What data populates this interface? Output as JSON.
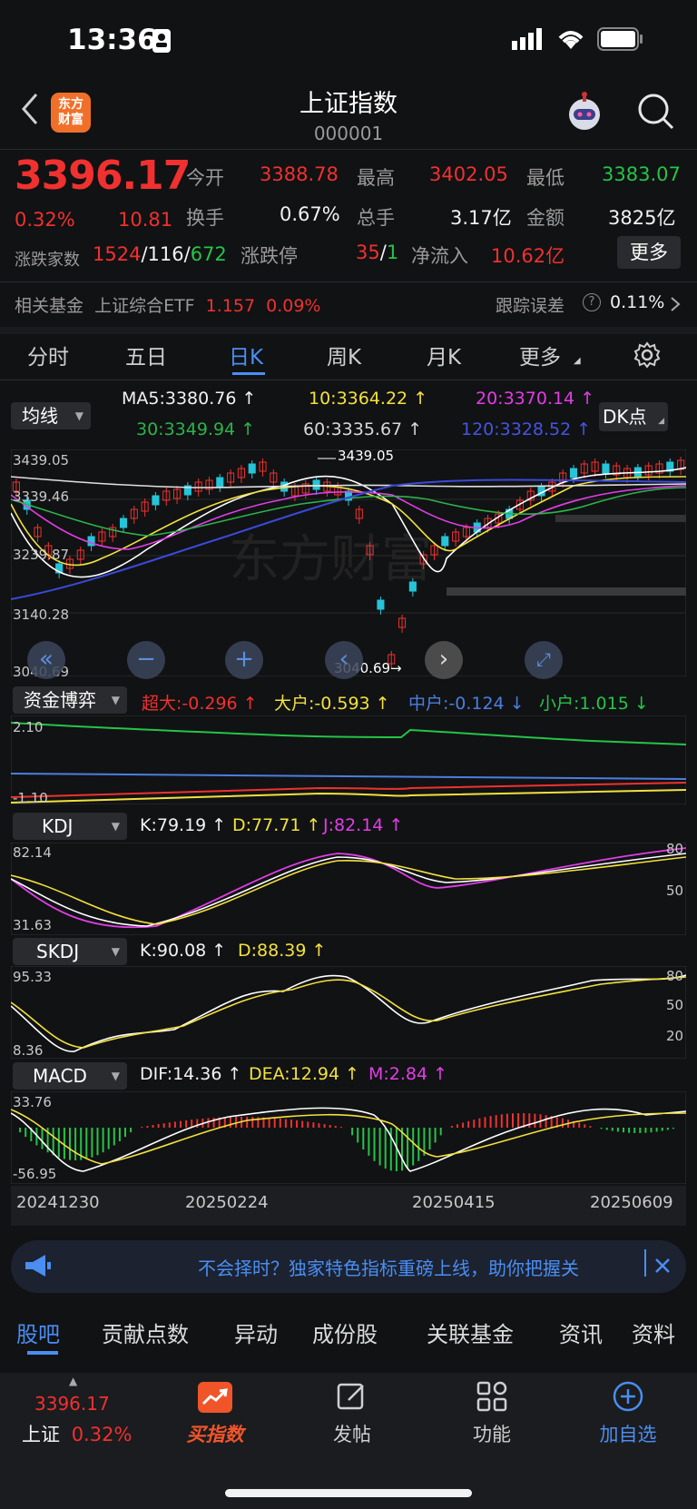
{
  "status": {
    "time": "13:36"
  },
  "header": {
    "title": "上证指数",
    "code": "000001",
    "logo_line1": "东方",
    "logo_line2": "财富"
  },
  "quote": {
    "price": "3396.17",
    "change_pct": "0.32%",
    "change": "10.81",
    "open_label": "今开",
    "open": "3388.78",
    "high_label": "最高",
    "high": "3402.05",
    "low_label": "最低",
    "low": "3383.07",
    "turnover_label": "换手",
    "turnover": "0.67%",
    "volume_label": "总手",
    "volume": "3.17亿",
    "amount_label": "金额",
    "amount": "3825亿",
    "updown_label": "涨跌家数",
    "up": "1524",
    "flat": "116",
    "down": "672",
    "limit_label": "涨跌停",
    "limit_up": "35",
    "limit_down": "1",
    "netflow_label": "净流入",
    "netflow": "10.62亿",
    "more": "更多"
  },
  "fund": {
    "label": "相关基金",
    "name": "上证综合ETF",
    "price": "1.157",
    "pct": "0.09%",
    "track_label": "跟踪误差",
    "track_value": "0.11%"
  },
  "tabs": [
    "分时",
    "五日",
    "日K",
    "周K",
    "月K",
    "更多"
  ],
  "ma_panel": {
    "selector": "均线",
    "ma5": "MA5:3380.76",
    "ma10": "10:3364.22",
    "ma20": "20:3370.14",
    "ma30": "30:3349.94",
    "ma60": "60:3335.67",
    "ma120": "120:3328.52",
    "dk": "DK点",
    "axis": [
      "3439.05",
      "3339.46",
      "3239.87",
      "3140.28",
      "3040.69"
    ],
    "max_label": "3439.05",
    "min_label": "3040.69→"
  },
  "fund_game": {
    "selector": "资金博弈",
    "super": "超大:-0.296",
    "large": "大户:-0.593",
    "medium": "中户:-0.124",
    "small": "小户:1.015",
    "axis_top": "2.10",
    "axis_bottom": "-1.10"
  },
  "kdj": {
    "selector": "KDJ",
    "k": "K:79.19",
    "d": "D:77.71",
    "j": "J:82.14",
    "axis_top": "82.14",
    "axis_bottom": "31.63",
    "r1": "80",
    "r2": "50"
  },
  "skdj": {
    "selector": "SKDJ",
    "k": "K:90.08",
    "d": "D:88.39",
    "axis_top": "95.33",
    "axis_bottom": "8.36",
    "r1": "80",
    "r2": "50",
    "r3": "20"
  },
  "macd": {
    "selector": "MACD",
    "dif": "DIF:14.36",
    "dea": "DEA:12.94",
    "m": "M:2.84",
    "axis_top": "33.76",
    "axis_bottom": "-56.95"
  },
  "dates": [
    "20241230",
    "20250224",
    "20250415",
    "20250609"
  ],
  "banner": {
    "text": "不会择时？独家特色指标重磅上线，助你把握关"
  },
  "bottom_tabs": [
    "股吧",
    "贡献点数",
    "异动",
    "成份股",
    "关联基金",
    "资讯",
    "资料"
  ],
  "nav": {
    "index_price": "3396.17",
    "index_name": "上证",
    "index_pct": "0.32%",
    "buy": "买指数",
    "post": "发帖",
    "func": "功能",
    "add": "加自选"
  },
  "colors": {
    "up": "#f0312f",
    "down": "#25c447",
    "accent": "#4a8ef2",
    "ma5": "#ffffff",
    "ma10": "#f3e13c",
    "ma20": "#e13ee6",
    "ma30": "#25a83a",
    "ma60": "#e0e0e0",
    "ma120": "#3a4ad8"
  }
}
